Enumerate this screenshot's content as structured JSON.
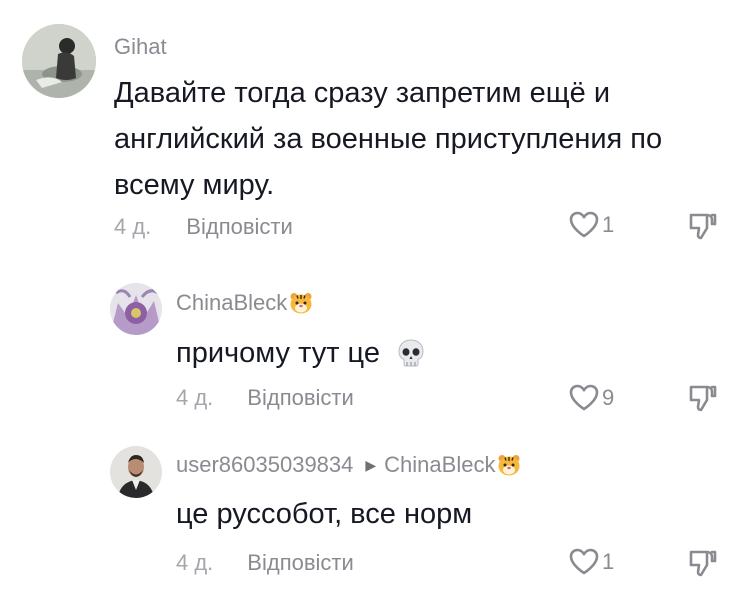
{
  "comments": [
    {
      "username": "Gihat",
      "text": "Давайте тогда сразу запретим ещё и английский за военные приступления по всему миру.",
      "date": "4 д.",
      "reply_label": "Відповісти",
      "likes": "1"
    },
    {
      "username": "ChinaBleck",
      "text": "причому тут це",
      "date": "4 д.",
      "reply_label": "Відповісти",
      "likes": "9"
    },
    {
      "username": "user86035039834",
      "reply_to": "ChinaBleck",
      "text": "це руссобот, все норм",
      "date": "4 д.",
      "reply_label": "Відповісти",
      "likes": "1"
    }
  ],
  "icons": {
    "like": "heart-outline-icon",
    "dislike": "thumbs-down-icon",
    "skull": "skull-emoji",
    "tiger": "tiger-face-emoji"
  },
  "colors": {
    "text": "#161823",
    "secondary": "#8a8b91",
    "date": "#a5a6ac"
  }
}
